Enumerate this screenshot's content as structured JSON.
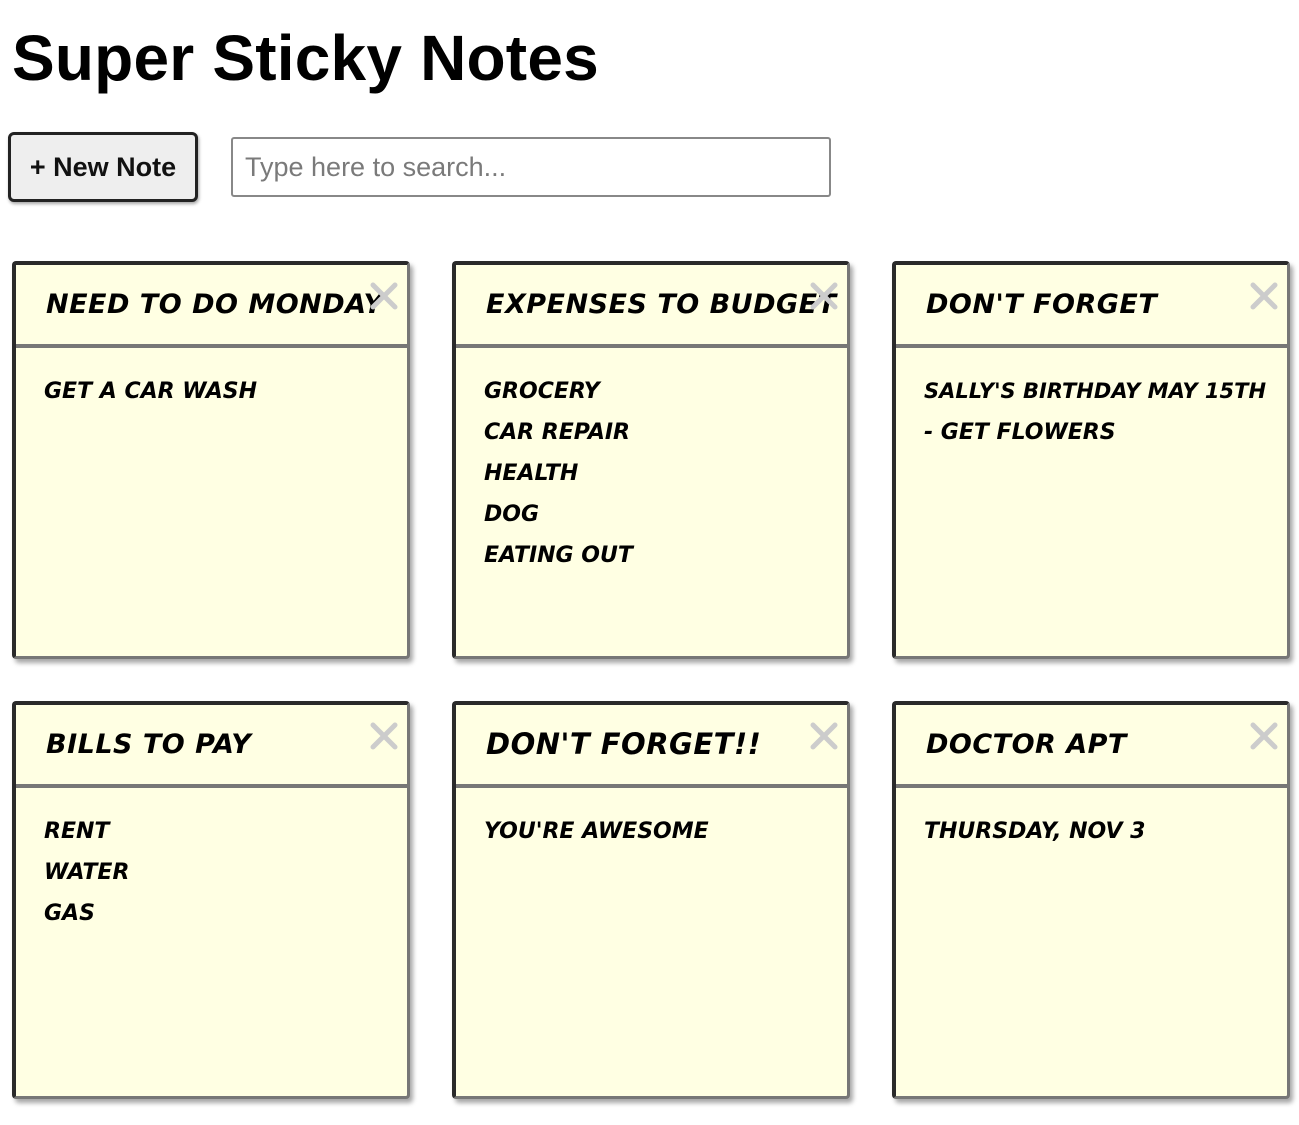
{
  "app": {
    "title": "Super Sticky Notes"
  },
  "toolbar": {
    "new_note_label": "+ New Note",
    "search_placeholder": "Type here to search..."
  },
  "notes": [
    {
      "title": "Need to do Monday",
      "body": [
        "Get a car wash"
      ]
    },
    {
      "title": "Expenses to budget",
      "body": [
        "Grocery",
        "car repair",
        "health",
        "dog",
        "eating out"
      ]
    },
    {
      "title": "Don't forget",
      "body": [
        "Sally's birthday May 15th",
        "- get flowers"
      ]
    },
    {
      "title": "Bills to pay",
      "body": [
        "rent",
        "water",
        "gas"
      ]
    },
    {
      "title": "DON'T FORGET!!",
      "body": [
        "You're awesome"
      ]
    },
    {
      "title": "Doctor apt",
      "body": [
        "Thursday, Nov 3"
      ]
    }
  ],
  "icons": {
    "close": "close-icon"
  },
  "colors": {
    "note_background": "#ffffe3",
    "close_icon": "#cccccc",
    "button_background": "#eeeeee"
  }
}
